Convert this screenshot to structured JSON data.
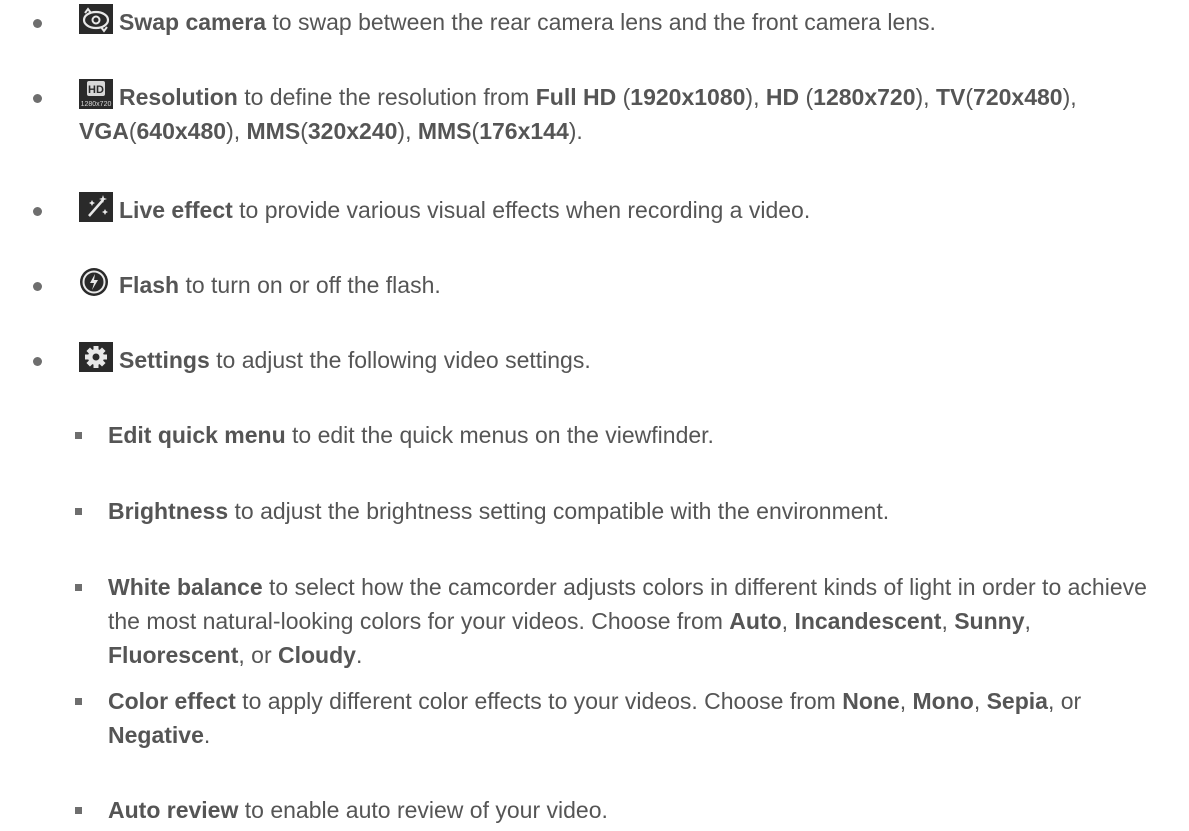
{
  "items": [
    {
      "icon": "swap-camera-icon",
      "title": "Swap camera",
      "text": " to swap between the rear camera lens and the front camera lens."
    },
    {
      "icon": "hd-resolution-icon",
      "icon_text": "HD",
      "icon_subtext": "1280x720",
      "title": "Resolution",
      "text_parts": [
        " to define the resolution from ",
        "Full HD",
        " (",
        "1920x1080",
        "), ",
        "HD",
        " (",
        "1280x720",
        "), ",
        "TV",
        "(",
        "720x480",
        "), ",
        "VGA",
        "(",
        "640x480",
        "), ",
        "MMS",
        "(",
        "320x240",
        "), ",
        "MMS",
        "(",
        "176x144",
        ")."
      ]
    },
    {
      "icon": "live-effect-icon",
      "title": "Live effect",
      "text": " to provide various visual effects when recording a video."
    },
    {
      "icon": "flash-icon",
      "title": "Flash",
      "text": " to turn on or off the flash."
    },
    {
      "icon": "settings-gear-icon",
      "title": "Settings",
      "text": " to adjust the following video settings."
    }
  ],
  "sub_items": [
    {
      "title": "Edit quick menu",
      "text": " to edit the quick menus on the viewfinder."
    },
    {
      "title": "Brightness",
      "text": " to adjust the brightness setting compatible with the environment."
    },
    {
      "title": "White balance",
      "text_parts": [
        " to select how the camcorder adjusts colors in different kinds of light in order to achieve the most natural-looking colors for your videos. Choose from ",
        "Auto",
        ", ",
        "Incandescent",
        ", ",
        "Sunny",
        ", ",
        "Fluorescent",
        ", or ",
        "Cloudy",
        "."
      ]
    },
    {
      "title": "Color effect",
      "text_parts": [
        " to apply different color effects to your videos. Choose from ",
        "None",
        ", ",
        "Mono",
        ", ",
        "Sepia",
        ", or ",
        "Negative",
        "."
      ]
    },
    {
      "title": "Auto review",
      "text": " to enable auto review of your video."
    }
  ]
}
